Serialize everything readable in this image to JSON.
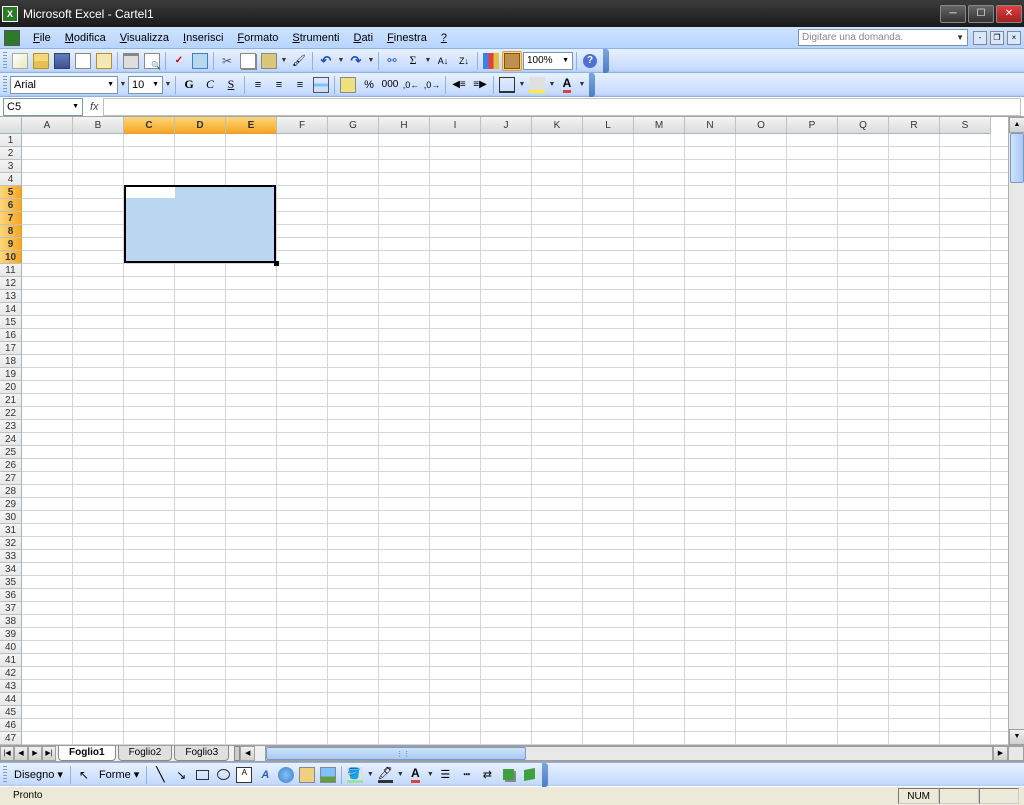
{
  "title": "Microsoft Excel - Cartel1",
  "ask": "Digitare una domanda.",
  "menus": [
    "File",
    "Modifica",
    "Visualizza",
    "Inserisci",
    "Formato",
    "Strumenti",
    "Dati",
    "Finestra",
    "?"
  ],
  "font_name": "Arial",
  "font_size": "10",
  "zoom": "100%",
  "name_box": "C5",
  "bold": "G",
  "italic": "C",
  "underline": "S",
  "columns": [
    "A",
    "B",
    "C",
    "D",
    "E",
    "F",
    "G",
    "H",
    "I",
    "J",
    "K",
    "L",
    "M",
    "N",
    "O",
    "P",
    "Q",
    "R",
    "S"
  ],
  "sel_cols": [
    "C",
    "D",
    "E"
  ],
  "sel_rows": [
    5,
    6,
    7,
    8,
    9,
    10
  ],
  "row_count": 47,
  "sheets": [
    "Foglio1",
    "Foglio2",
    "Foglio3"
  ],
  "active_sheet": "Foglio1",
  "draw_label": "Disegno",
  "forms_label": "Forme",
  "status": "Pronto",
  "numlock": "NUM"
}
